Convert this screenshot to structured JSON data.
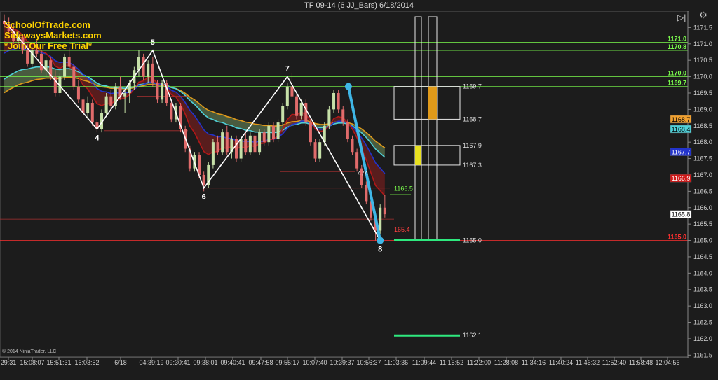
{
  "header": {
    "title": "TF 09-14 (6 JJ_Bars)  6/18/2014"
  },
  "promo": {
    "line1": "SchoolOfTrade.com",
    "line2": "SidewaysMarkets.com",
    "line3": "*Join Our Free Trial*"
  },
  "copyright": "© 2014 NinjaTrader, LLC",
  "icons": {
    "play": "play-icon",
    "settings": "gear-icon"
  },
  "colors": {
    "background": "#1c1c1c",
    "up_bar": "#c6e0a8",
    "down_bar": "#e06b6b",
    "zigzag": "#ffffff",
    "projection": "#3fb6e6",
    "level_green": "#7cff4d",
    "level_red": "#ff3030",
    "target": "#2ee87e"
  },
  "chart_data": {
    "type": "candlestick",
    "title": "TF 09-14 (6 JJ_Bars)  6/18/2014",
    "ylim": [
      1161.4,
      1172.0
    ],
    "y_ticks": [
      "1171.5",
      "1171.0",
      "1170.5",
      "1170.0",
      "1169.5",
      "1169.0",
      "1168.5",
      "1168.0",
      "1167.5",
      "1167.0",
      "1166.5",
      "1166.0",
      "1165.5",
      "1165.0",
      "1164.5",
      "1164.0",
      "1163.5",
      "1163.0",
      "1162.5",
      "1162.0",
      "1161.5"
    ],
    "x_ticks": [
      "29:31",
      "15:08:07",
      "15:51:31",
      "16:03:52",
      "6/18",
      "04:39:19",
      "09:30:41",
      "09:38:01",
      "09:40:41",
      "09:47:58",
      "09:55:17",
      "10:07:40",
      "10:39:37",
      "10:56:37",
      "11:03:36",
      "11:09:44",
      "11:15:52",
      "11:22:00",
      "11:28:08",
      "11:34:16",
      "11:40:24",
      "11:46:32",
      "11:52:40",
      "11:58:48",
      "12:04:56"
    ],
    "swing_points": [
      {
        "label": "4",
        "price": 1168.4
      },
      {
        "label": "5",
        "price": 1170.8
      },
      {
        "label": "6",
        "price": 1166.6
      },
      {
        "label": "7",
        "price": 1170.0
      },
      {
        "label": "8",
        "price": 1165.0
      }
    ],
    "horizontal_levels": [
      {
        "label": "1171.0",
        "price": 1171.05,
        "color": "#7cff4d"
      },
      {
        "label": "1170.8",
        "price": 1170.8,
        "color": "#7cff4d"
      },
      {
        "label": "1170.0",
        "price": 1170.0,
        "color": "#7cff4d"
      },
      {
        "label": "1169.7",
        "price": 1169.7,
        "color": "#7cff4d"
      },
      {
        "label": "1165.0",
        "price": 1165.0,
        "color": "#ff3030"
      }
    ],
    "price_tags": [
      {
        "label": "1168.7",
        "price": 1168.7,
        "bg": "#f0a030",
        "fg": "#000000"
      },
      {
        "label": "1168.4",
        "price": 1168.4,
        "bg": "#4fd0d8",
        "fg": "#000000"
      },
      {
        "label": "1167.7",
        "price": 1167.7,
        "bg": "#2233cc",
        "fg": "#ffffff"
      },
      {
        "label": "1166.9",
        "price": 1166.9,
        "bg": "#d01818",
        "fg": "#ffffff"
      },
      {
        "label": "1165.8",
        "price": 1165.8,
        "bg": "#ffffff",
        "fg": "#000000"
      }
    ],
    "zone_boxes": [
      {
        "top": 1169.7,
        "bottom": 1168.7,
        "top_label": "1169.7",
        "bottom_label": "1168.7",
        "fill": "#e09a1a"
      },
      {
        "top": 1167.9,
        "bottom": 1167.3,
        "top_label": "1167.9",
        "bottom_label": "1167.3",
        "fill": "#e8e020"
      }
    ],
    "targets": [
      {
        "label": "1165.0",
        "price": 1165.0
      },
      {
        "label": "1162.1",
        "price": 1162.1
      }
    ],
    "annotations": [
      {
        "text": "1166.5",
        "price": 1166.58,
        "color": "#7cff4d"
      },
      {
        "text": "165.4",
        "price": 1165.33,
        "color": "#ff4040"
      },
      {
        "text": "474",
        "price": 1167.05,
        "color": "#ffffff"
      }
    ],
    "bars": [
      [
        1171.7,
        1171.9,
        1171.5,
        1171.6
      ],
      [
        1171.6,
        1171.8,
        1171.3,
        1171.4
      ],
      [
        1171.4,
        1171.6,
        1171.0,
        1171.1
      ],
      [
        1171.1,
        1171.4,
        1170.9,
        1171.2
      ],
      [
        1171.2,
        1171.3,
        1170.7,
        1170.8
      ],
      [
        1170.8,
        1171.0,
        1170.3,
        1170.4
      ],
      [
        1170.4,
        1170.9,
        1170.3,
        1170.8
      ],
      [
        1170.8,
        1171.1,
        1170.6,
        1170.7
      ],
      [
        1170.7,
        1170.8,
        1170.1,
        1170.2
      ],
      [
        1170.2,
        1170.6,
        1170.0,
        1170.5
      ],
      [
        1170.5,
        1170.6,
        1169.9,
        1170.0
      ],
      [
        1170.0,
        1170.2,
        1169.4,
        1169.5
      ],
      [
        1169.5,
        1170.1,
        1169.4,
        1170.0
      ],
      [
        1170.0,
        1170.7,
        1169.9,
        1170.6
      ],
      [
        1170.6,
        1170.9,
        1170.2,
        1170.3
      ],
      [
        1170.3,
        1170.4,
        1169.6,
        1169.7
      ],
      [
        1169.7,
        1169.9,
        1169.2,
        1169.3
      ],
      [
        1169.3,
        1169.4,
        1168.8,
        1168.9
      ],
      [
        1168.9,
        1169.4,
        1168.7,
        1169.2
      ],
      [
        1169.2,
        1169.3,
        1168.5,
        1168.6
      ],
      [
        1168.6,
        1168.7,
        1168.3,
        1168.4
      ],
      [
        1168.4,
        1169.0,
        1168.3,
        1168.9
      ],
      [
        1168.9,
        1169.5,
        1168.8,
        1169.4
      ],
      [
        1169.4,
        1169.6,
        1169.0,
        1169.1
      ],
      [
        1169.1,
        1169.8,
        1169.0,
        1169.7
      ],
      [
        1169.7,
        1170.0,
        1169.3,
        1169.4
      ],
      [
        1169.4,
        1169.6,
        1168.9,
        1169.5
      ],
      [
        1169.5,
        1169.9,
        1169.2,
        1169.8
      ],
      [
        1169.8,
        1170.3,
        1169.6,
        1170.2
      ],
      [
        1170.2,
        1170.8,
        1170.0,
        1170.6
      ],
      [
        1170.6,
        1170.7,
        1169.9,
        1170.0
      ],
      [
        1170.0,
        1170.5,
        1169.8,
        1170.4
      ],
      [
        1170.4,
        1170.6,
        1169.7,
        1169.8
      ],
      [
        1169.8,
        1169.9,
        1169.2,
        1169.3
      ],
      [
        1169.3,
        1169.9,
        1169.2,
        1169.8
      ],
      [
        1169.8,
        1169.9,
        1169.1,
        1169.2
      ],
      [
        1169.2,
        1169.3,
        1168.6,
        1168.7
      ],
      [
        1168.7,
        1169.2,
        1168.6,
        1169.1
      ],
      [
        1169.1,
        1169.2,
        1168.3,
        1168.4
      ],
      [
        1168.4,
        1168.5,
        1167.7,
        1167.8
      ],
      [
        1167.8,
        1167.9,
        1167.1,
        1167.2
      ],
      [
        1167.2,
        1167.7,
        1167.1,
        1167.6
      ],
      [
        1167.6,
        1167.7,
        1166.9,
        1167.0
      ],
      [
        1167.0,
        1167.1,
        1166.5,
        1166.7
      ],
      [
        1166.7,
        1167.4,
        1166.6,
        1167.3
      ],
      [
        1167.3,
        1168.1,
        1167.2,
        1168.0
      ],
      [
        1168.0,
        1168.2,
        1167.6,
        1167.7
      ],
      [
        1167.7,
        1168.4,
        1167.6,
        1168.3
      ],
      [
        1168.3,
        1168.5,
        1167.6,
        1167.7
      ],
      [
        1167.7,
        1168.2,
        1167.5,
        1168.1
      ],
      [
        1168.1,
        1168.2,
        1167.4,
        1167.5
      ],
      [
        1167.5,
        1168.2,
        1167.4,
        1168.1
      ],
      [
        1168.1,
        1168.3,
        1167.6,
        1167.7
      ],
      [
        1167.7,
        1168.3,
        1167.6,
        1168.2
      ],
      [
        1168.2,
        1168.3,
        1167.6,
        1167.7
      ],
      [
        1167.7,
        1168.4,
        1167.6,
        1168.3
      ],
      [
        1168.3,
        1168.4,
        1167.9,
        1168.0
      ],
      [
        1168.0,
        1168.6,
        1167.9,
        1168.5
      ],
      [
        1168.5,
        1168.6,
        1168.0,
        1168.1
      ],
      [
        1168.1,
        1168.7,
        1168.0,
        1168.6
      ],
      [
        1168.6,
        1169.2,
        1168.5,
        1169.1
      ],
      [
        1169.1,
        1169.8,
        1169.0,
        1169.7
      ],
      [
        1169.7,
        1170.1,
        1169.3,
        1169.4
      ],
      [
        1169.4,
        1169.5,
        1168.7,
        1168.8
      ],
      [
        1168.8,
        1169.3,
        1168.7,
        1169.2
      ],
      [
        1169.2,
        1169.3,
        1168.5,
        1168.6
      ],
      [
        1168.6,
        1168.7,
        1167.9,
        1168.0
      ],
      [
        1168.0,
        1168.1,
        1167.4,
        1167.5
      ],
      [
        1167.5,
        1168.1,
        1167.4,
        1168.0
      ],
      [
        1168.0,
        1168.6,
        1167.9,
        1168.5
      ],
      [
        1168.5,
        1169.1,
        1168.4,
        1169.0
      ],
      [
        1169.0,
        1169.6,
        1168.9,
        1169.5
      ],
      [
        1169.5,
        1169.6,
        1168.9,
        1169.0
      ],
      [
        1169.0,
        1169.1,
        1168.5,
        1168.6
      ],
      [
        1168.6,
        1168.7,
        1168.0,
        1168.1
      ],
      [
        1168.1,
        1168.2,
        1167.6,
        1167.7
      ],
      [
        1167.7,
        1167.8,
        1167.1,
        1167.2
      ],
      [
        1167.2,
        1167.3,
        1166.6,
        1166.7
      ],
      [
        1166.7,
        1166.8,
        1166.1,
        1166.2
      ],
      [
        1166.2,
        1166.3,
        1165.6,
        1165.7
      ],
      [
        1165.7,
        1165.8,
        1165.0,
        1165.3
      ],
      [
        1165.3,
        1166.1,
        1165.2,
        1166.0
      ],
      [
        1166.0,
        1166.4,
        1165.7,
        1165.8
      ]
    ]
  }
}
